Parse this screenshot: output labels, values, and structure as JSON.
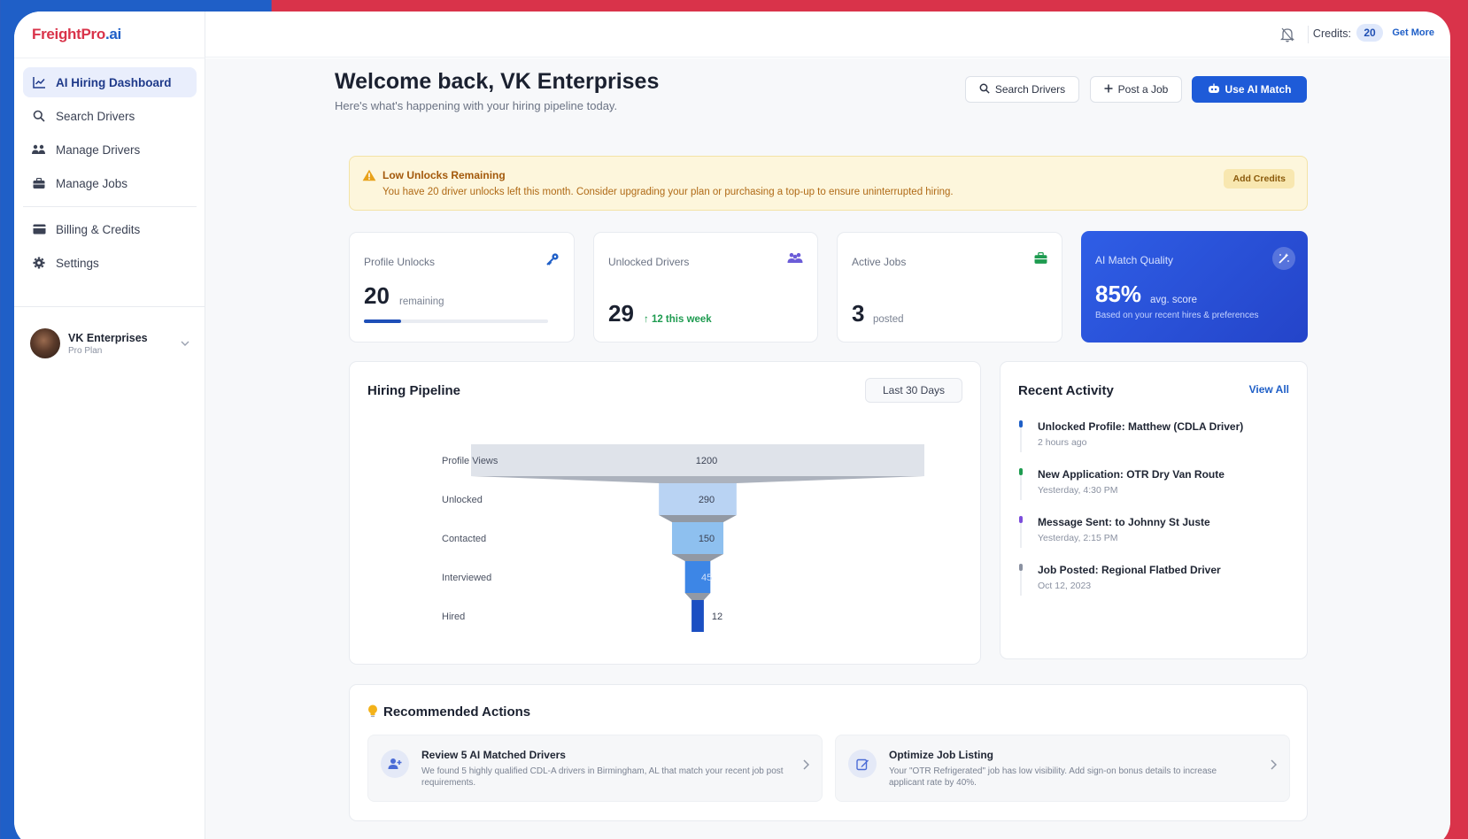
{
  "brand": {
    "part1": "FreightPro",
    "part2": ".ai"
  },
  "sidebar": {
    "items": [
      {
        "label": "AI Hiring Dashboard",
        "icon": "chart-line-icon"
      },
      {
        "label": "Search Drivers",
        "icon": "search-icon"
      },
      {
        "label": "Manage Drivers",
        "icon": "users-icon"
      },
      {
        "label": "Manage Jobs",
        "icon": "briefcase-icon"
      },
      {
        "label": "Billing & Credits",
        "icon": "credit-card-icon"
      },
      {
        "label": "Settings",
        "icon": "gear-icon"
      }
    ],
    "user": {
      "name": "VK Enterprises",
      "plan": "Pro Plan"
    }
  },
  "topbar": {
    "credits_label": "Credits:",
    "credits_value": "20",
    "get_more": "Get More"
  },
  "header": {
    "title": "Welcome back, VK Enterprises",
    "subtitle": "Here's what's happening with your hiring pipeline today.",
    "search_btn": "Search Drivers",
    "post_btn": "Post a Job",
    "ai_btn": "Use AI Match"
  },
  "alert": {
    "title": "Low Unlocks Remaining",
    "message": "You have 20 driver unlocks left this month. Consider upgrading your plan or purchasing a top-up to ensure uninterrupted hiring.",
    "action": "Add Credits"
  },
  "stats": {
    "profile_unlocks": {
      "label": "Profile Unlocks",
      "value": "20",
      "unit": "remaining",
      "progress": 0.2
    },
    "unlocked_drivers": {
      "label": "Unlocked Drivers",
      "value": "29",
      "change": "↑ 12 this week"
    },
    "active_jobs": {
      "label": "Active Jobs",
      "value": "3",
      "unit": "posted"
    },
    "ai_match": {
      "label": "AI Match Quality",
      "value": "85%",
      "unit": "avg. score",
      "note": "Based on your recent hires & preferences"
    }
  },
  "pipeline": {
    "title": "Hiring Pipeline",
    "range": "Last 30 Days"
  },
  "chart_data": {
    "type": "bar",
    "title": "Hiring Pipeline",
    "categories": [
      "Profile Views",
      "Unlocked",
      "Contacted",
      "Interviewed",
      "Hired"
    ],
    "values": [
      1200,
      290,
      150,
      45,
      12
    ],
    "value_labels": [
      "1200",
      "290",
      "150",
      "45",
      "12"
    ],
    "colors": [
      "#dfe3ea",
      "#b9d3f3",
      "#8ec0ef",
      "#3d86e6",
      "#1b4fc2"
    ]
  },
  "activity": {
    "title": "Recent Activity",
    "view_all": "View All",
    "items": [
      {
        "title": "Unlocked Profile: Matthew (CDLA Driver)",
        "time": "2 hours ago",
        "color": "#1f5fc7"
      },
      {
        "title": "New Application: OTR Dry Van Route",
        "time": "Yesterday, 4:30 PM",
        "color": "#1e9b50"
      },
      {
        "title": "Message Sent: to Johnny St Juste",
        "time": "Yesterday, 2:15 PM",
        "color": "#7c4ddb"
      },
      {
        "title": "Job Posted: Regional Flatbed Driver",
        "time": "Oct 12, 2023",
        "color": "#8a91a1"
      }
    ]
  },
  "recommended": {
    "title": "Recommended Actions",
    "items": [
      {
        "title": "Review 5 AI Matched Drivers",
        "desc": "We found 5 highly qualified CDL-A drivers in Birmingham, AL that match your recent job post requirements.",
        "icon": "user-plus-icon"
      },
      {
        "title": "Optimize Job Listing",
        "desc": "Your \"OTR Refrigerated\" job has low visibility. Add sign-on bonus details to increase applicant rate by 40%.",
        "icon": "edit-icon"
      }
    ]
  }
}
